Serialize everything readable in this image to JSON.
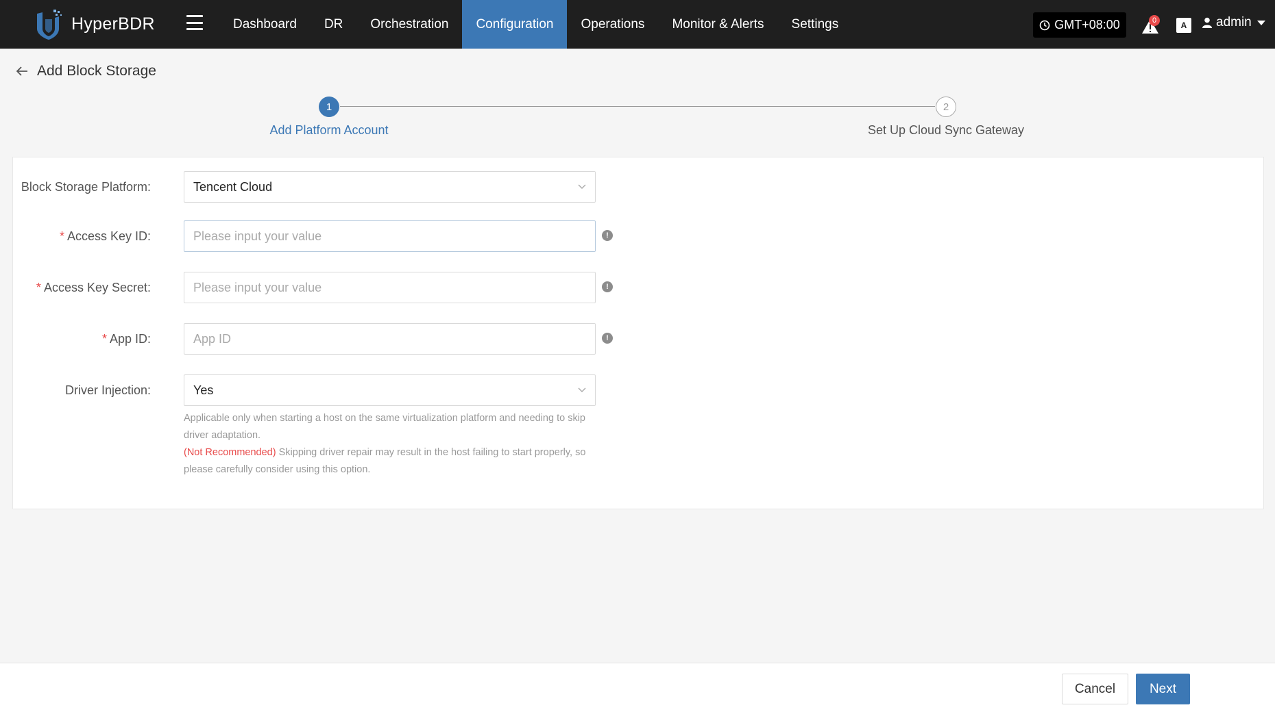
{
  "app": {
    "name": "HyperBDR"
  },
  "nav": {
    "items": [
      {
        "label": "Dashboard"
      },
      {
        "label": "DR"
      },
      {
        "label": "Orchestration"
      },
      {
        "label": "Configuration",
        "active": true
      },
      {
        "label": "Operations"
      },
      {
        "label": "Monitor & Alerts"
      },
      {
        "label": "Settings"
      }
    ]
  },
  "header_right": {
    "timezone": "GMT+08:00",
    "alert_count": "0",
    "lang_icon_text": "A",
    "user": "admin"
  },
  "page": {
    "title": "Add Block Storage"
  },
  "steps": [
    {
      "number": "1",
      "label": "Add Platform Account",
      "state": "active"
    },
    {
      "number": "2",
      "label": "Set Up Cloud Sync Gateway",
      "state": "pending"
    }
  ],
  "form": {
    "platform": {
      "label": "Block Storage Platform:",
      "value": "Tencent Cloud"
    },
    "access_key_id": {
      "required_mark": "*",
      "label": "Access Key ID:",
      "placeholder": "Please input your value"
    },
    "access_key_secret": {
      "required_mark": "*",
      "label": "Access Key Secret:",
      "placeholder": "Please input your value"
    },
    "app_id": {
      "required_mark": "*",
      "label": "App ID:",
      "placeholder": "App ID"
    },
    "driver_injection": {
      "label": "Driver Injection:",
      "value": "Yes",
      "help_line1": "Applicable only when starting a host on the same virtualization platform and needing to skip driver adaptation.",
      "help_warn": "(Not Recommended)",
      "help_line2": " Skipping driver repair may result in the host failing to start properly, so please carefully consider using this option."
    }
  },
  "footer": {
    "cancel_label": "Cancel",
    "next_label": "Next"
  },
  "colors": {
    "accent": "#3c78b5",
    "topbar": "#1f1f1f",
    "danger": "#e84a4a"
  }
}
